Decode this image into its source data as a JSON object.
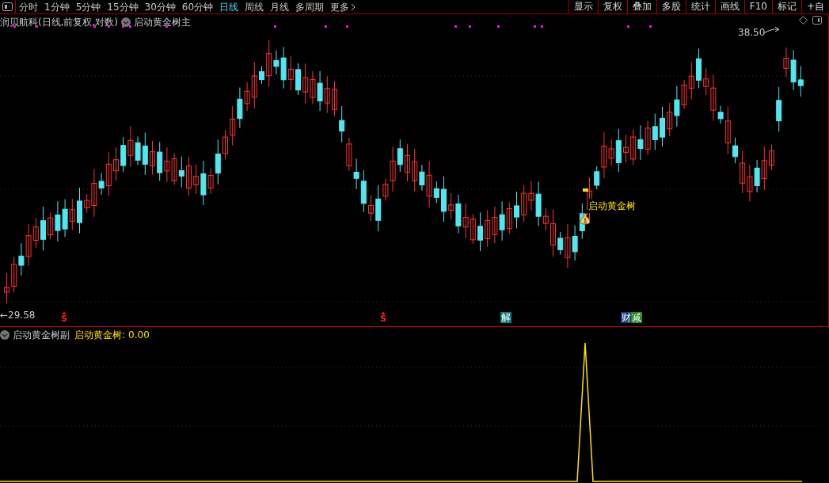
{
  "toolbar": {
    "periods": [
      {
        "label": "分时",
        "selected": false
      },
      {
        "label": "1分钟",
        "selected": false
      },
      {
        "label": "5分钟",
        "selected": false
      },
      {
        "label": "15分钟",
        "selected": false
      },
      {
        "label": "30分钟",
        "selected": false
      },
      {
        "label": "60分钟",
        "selected": false
      },
      {
        "label": "日线",
        "selected": true
      },
      {
        "label": "周线",
        "selected": false
      },
      {
        "label": "月线",
        "selected": false
      },
      {
        "label": "多周期",
        "selected": false
      }
    ],
    "more": "更多",
    "buttons": [
      "显示",
      "复权",
      "叠加",
      "多股",
      "统计",
      "画线",
      "F10",
      "标记",
      "+自"
    ]
  },
  "main_panel": {
    "title": "润贝航科(日线,前复权,对数)",
    "indicator": "启动黄金树主",
    "high_label": "38.50",
    "low_label": "←29.58",
    "signal_label": "启动黄金树",
    "markers": [
      {
        "kind": "s",
        "text": "S"
      },
      {
        "kind": "s",
        "text": "S"
      },
      {
        "kind": "tag",
        "text": "解",
        "color": "#0a7c7c"
      },
      {
        "kind": "tag",
        "text": "财",
        "color": "#173d7a"
      },
      {
        "kind": "tag",
        "text": "减",
        "color": "#1f8a1f"
      }
    ]
  },
  "sub_panel": {
    "title": "启动黄金树副",
    "series_label": "启动黄金树:",
    "value": "0.00"
  }
}
